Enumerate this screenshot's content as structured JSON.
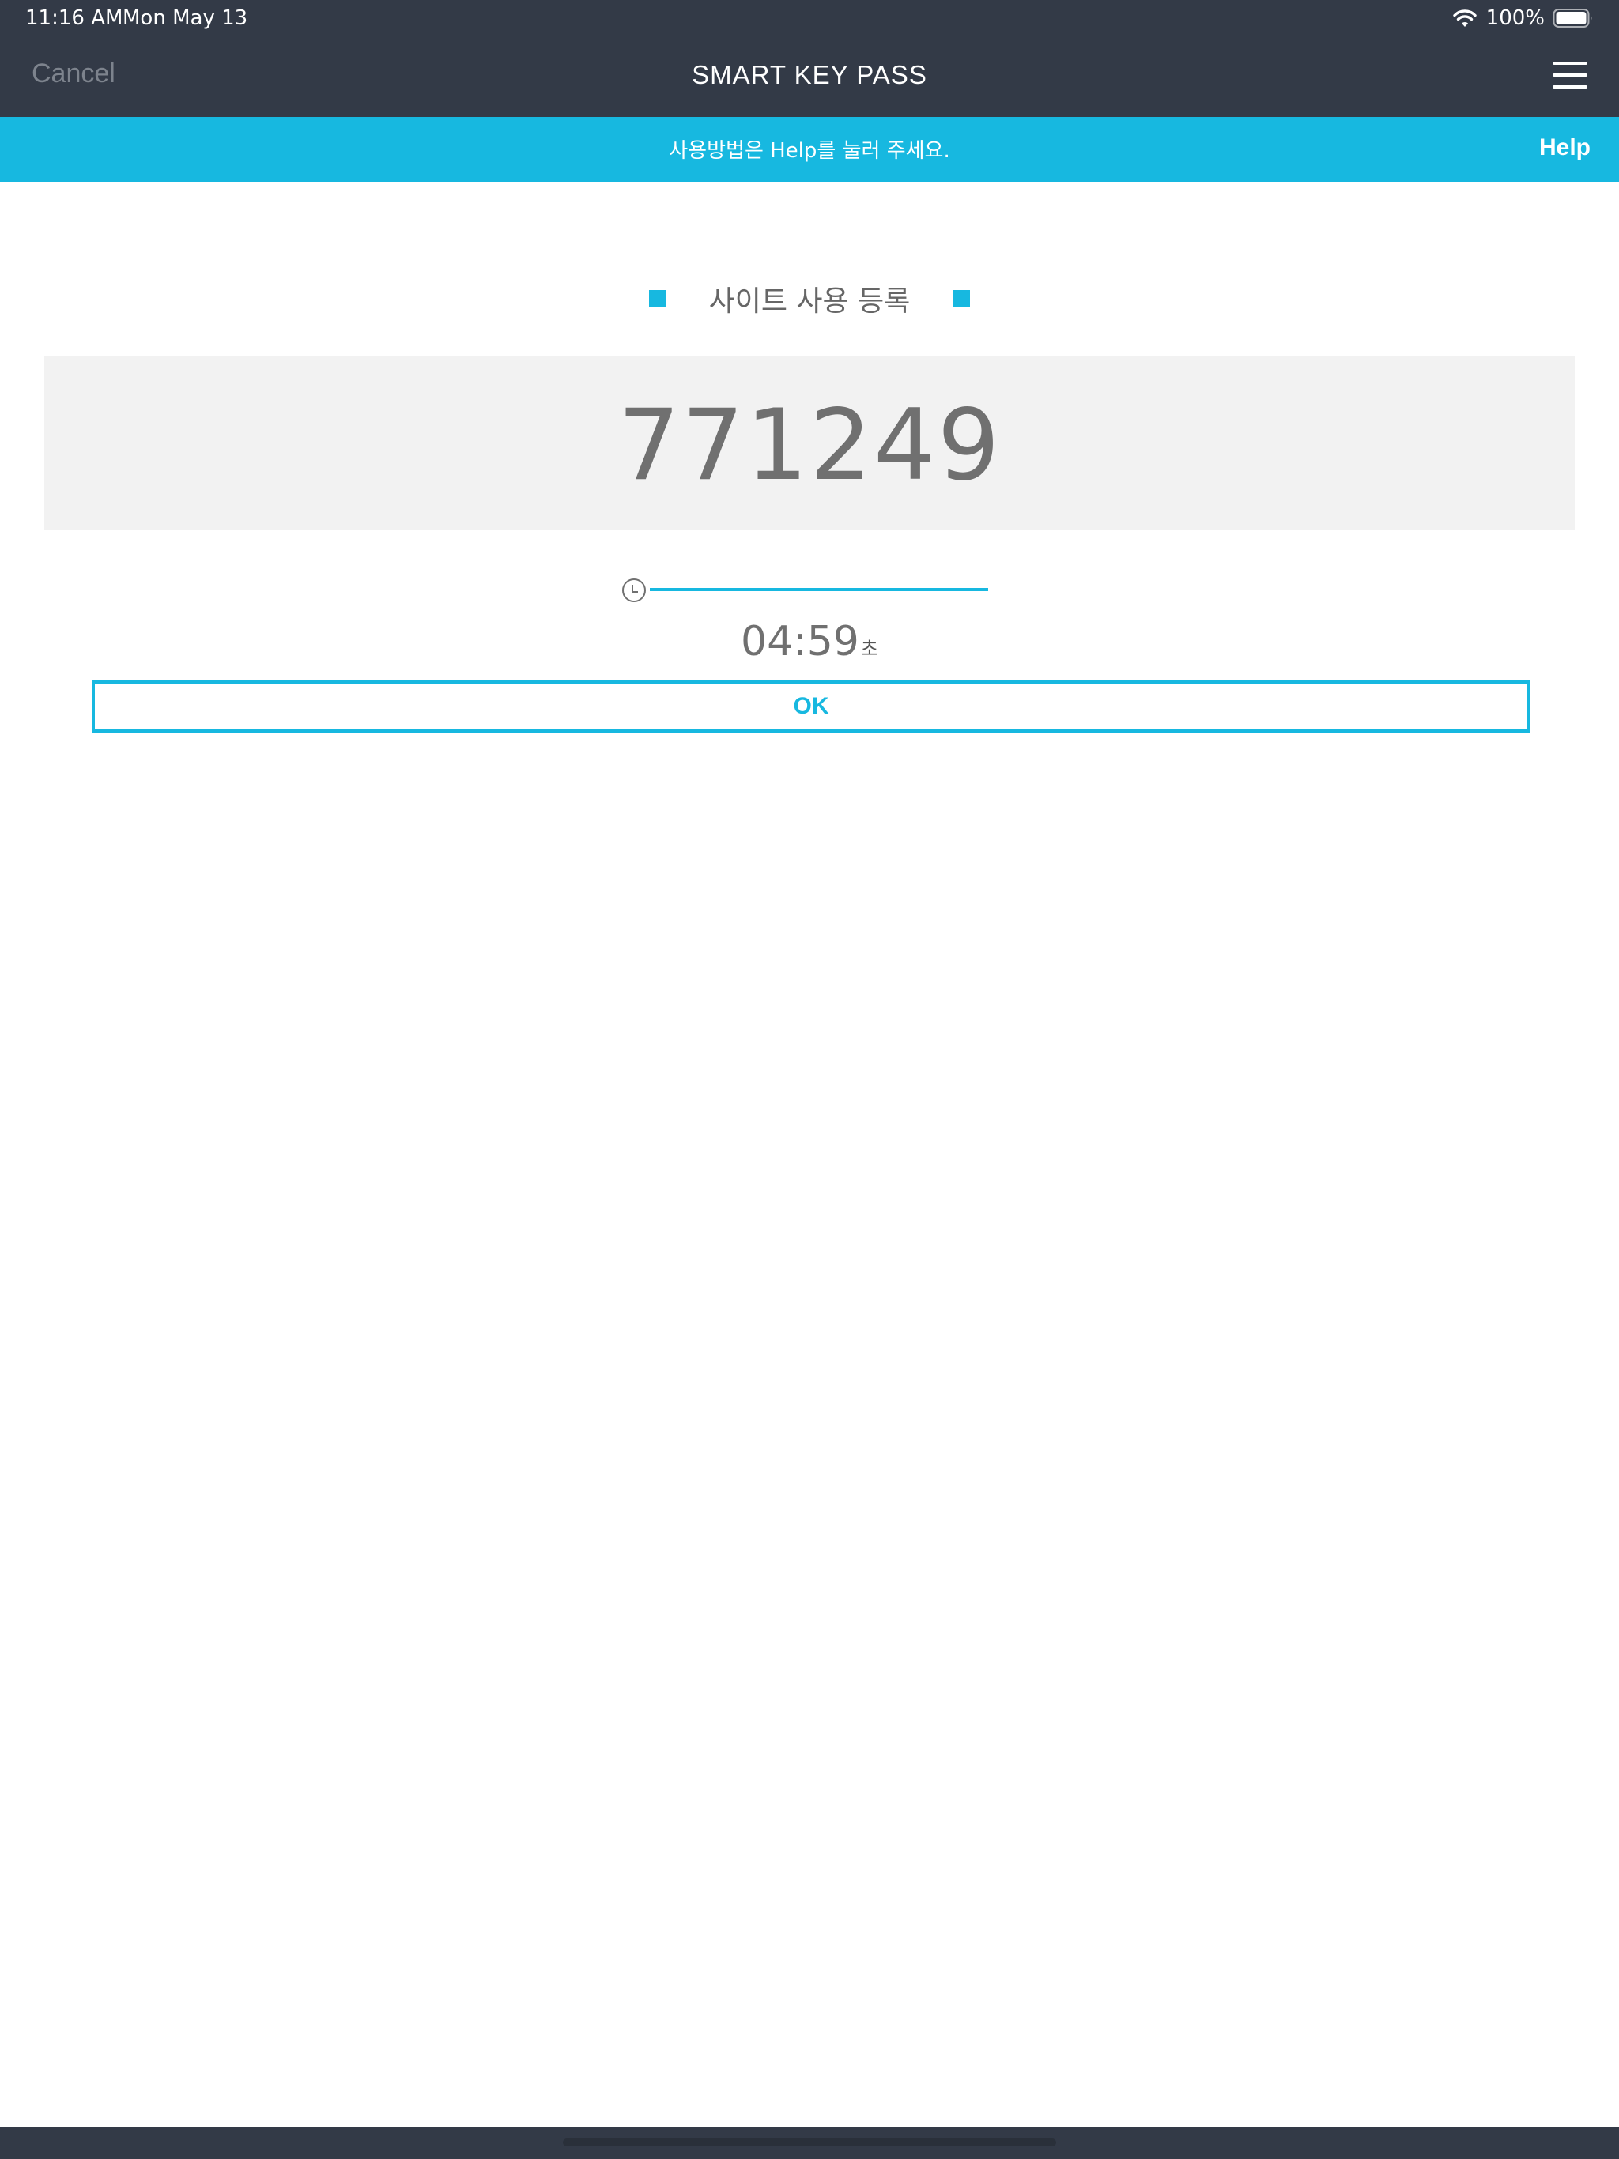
{
  "status_bar": {
    "time": "11:16 AM",
    "date": "Mon May 13",
    "battery": "100%",
    "icons": [
      "wifi-icon",
      "battery-icon"
    ]
  },
  "nav": {
    "cancel_label": "Cancel",
    "title": "SMART KEY PASS",
    "menu_icon": "hamburger-menu-icon"
  },
  "help_bar": {
    "message": "사용방법은 Help를 눌러 주세요.",
    "help_label": "Help"
  },
  "section": {
    "title": "사이트 사용 등록"
  },
  "code": {
    "value": "771249"
  },
  "timer": {
    "icon": "clock-icon",
    "remaining": "04:59",
    "unit": "초",
    "progress_fraction": 1.0
  },
  "ok_button": {
    "label": "OK"
  },
  "colors": {
    "accent": "#17b8e0",
    "header_bg": "#333a47",
    "code_bg": "#f2f2f2",
    "text_gray": "#707070"
  }
}
